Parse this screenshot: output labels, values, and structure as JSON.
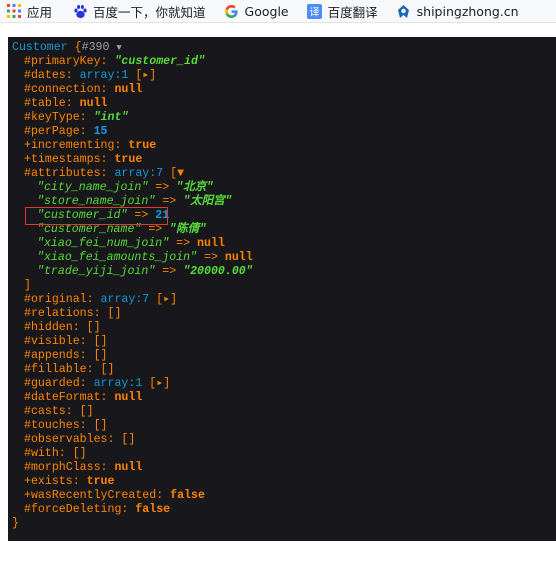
{
  "bookmarks": [
    {
      "icon": "apps-grid-icon",
      "label": "应用"
    },
    {
      "icon": "baidu-paw-icon",
      "label": "百度一下，你就知道"
    },
    {
      "icon": "google-g-icon",
      "label": "Google"
    },
    {
      "icon": "translate-icon",
      "label": "百度翻译"
    },
    {
      "icon": "site-logo-icon",
      "label": "shipingzhong.cn"
    }
  ],
  "dump": {
    "class_name": "Customer",
    "open_brace": "{",
    "object_id": "#390",
    "close_brace": "}",
    "props": [
      {
        "key": "#primaryKey",
        "sep": ": ",
        "value": "\"customer_id\"",
        "type": "str"
      },
      {
        "key": "#dates",
        "sep": ": ",
        "value": "array:1",
        "tail": "[▸]",
        "type": "arr"
      },
      {
        "key": "#connection",
        "sep": ": ",
        "value": "null",
        "type": "const"
      },
      {
        "key": "#table",
        "sep": ": ",
        "value": "null",
        "type": "const"
      },
      {
        "key": "#keyType",
        "sep": ": ",
        "value": "\"int\"",
        "type": "str"
      },
      {
        "key": "#perPage",
        "sep": ": ",
        "value": "15",
        "type": "num"
      },
      {
        "key": "+incrementing",
        "sep": ": ",
        "value": "true",
        "type": "const"
      },
      {
        "key": "+timestamps",
        "sep": ": ",
        "value": "true",
        "type": "const"
      },
      {
        "key": "#attributes",
        "sep": ": ",
        "value": "array:7",
        "tail": "[▼",
        "type": "arr"
      }
    ],
    "attributes": [
      {
        "key": "\"city_name_join\"",
        "arrow": " => ",
        "value": "\"北京\"",
        "type": "str"
      },
      {
        "key": "\"store_name_join\"",
        "arrow": " => ",
        "value": "\"太阳宫\"",
        "type": "str"
      },
      {
        "key": "\"customer_id\"",
        "arrow": " => ",
        "value": "21",
        "type": "num"
      },
      {
        "key": "\"customer_name\"",
        "arrow": " => ",
        "value": "\"陈倩\"",
        "type": "str"
      },
      {
        "key": "\"xiao_fei_num_join\"",
        "arrow": " => ",
        "value": "null",
        "type": "const"
      },
      {
        "key": "\"xiao_fei_amounts_join\"",
        "arrow": " => ",
        "value": "null",
        "type": "const"
      },
      {
        "key": "\"trade_yiji_join\"",
        "arrow": " => ",
        "value": "\"20000.00\"",
        "type": "str"
      }
    ],
    "attributes_close": "]",
    "props2": [
      {
        "key": "#original",
        "sep": ": ",
        "value": "array:7",
        "tail": "[▸]",
        "type": "arr"
      },
      {
        "key": "#relations",
        "sep": ": ",
        "value": "[]",
        "type": "plain"
      },
      {
        "key": "#hidden",
        "sep": ": ",
        "value": "[]",
        "type": "plain"
      },
      {
        "key": "#visible",
        "sep": ": ",
        "value": "[]",
        "type": "plain"
      },
      {
        "key": "#appends",
        "sep": ": ",
        "value": "[]",
        "type": "plain"
      },
      {
        "key": "#fillable",
        "sep": ": ",
        "value": "[]",
        "type": "plain"
      },
      {
        "key": "#guarded",
        "sep": ": ",
        "value": "array:1",
        "tail": "[▸]",
        "type": "arr"
      },
      {
        "key": "#dateFormat",
        "sep": ": ",
        "value": "null",
        "type": "const"
      },
      {
        "key": "#casts",
        "sep": ": ",
        "value": "[]",
        "type": "plain"
      },
      {
        "key": "#touches",
        "sep": ": ",
        "value": "[]",
        "type": "plain"
      },
      {
        "key": "#observables",
        "sep": ": ",
        "value": "[]",
        "type": "plain"
      },
      {
        "key": "#with",
        "sep": ": ",
        "value": "[]",
        "type": "plain"
      },
      {
        "key": "#morphClass",
        "sep": ": ",
        "value": "null",
        "type": "const"
      },
      {
        "key": "+exists",
        "sep": ": ",
        "value": "true",
        "type": "const"
      },
      {
        "key": "+wasRecentlyCreated",
        "sep": ": ",
        "value": "false",
        "type": "const"
      },
      {
        "key": "#forceDeleting",
        "sep": ": ",
        "value": "false",
        "type": "const"
      }
    ]
  },
  "colors": {
    "background": "#18171b",
    "key": "#ff8400",
    "string": "#56db3a",
    "number": "#1299da",
    "highlight_box": "#e0392f"
  }
}
